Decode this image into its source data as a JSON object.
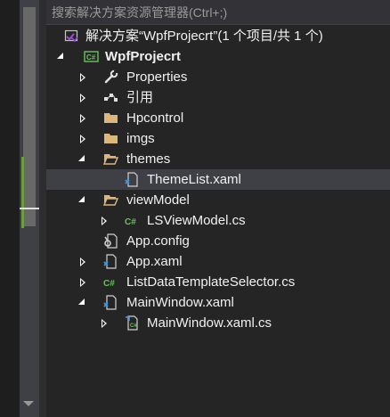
{
  "search": {
    "placeholder": "搜索解决方案资源管理器(Ctrl+;)"
  },
  "tree": {
    "solution": "解决方案“WpfProjecrt”(1 个项目/共 1 个)",
    "project": "WpfProjecrt",
    "items": {
      "properties": "Properties",
      "references": "引用",
      "hpcontrol": "Hpcontrol",
      "imgs": "imgs",
      "themes": "themes",
      "themelist": "ThemeList.xaml",
      "viewmodel": "viewModel",
      "lsviewmodel": "LSViewModel.cs",
      "appconfig": "App.config",
      "appxaml": "App.xaml",
      "selector": "ListDataTemplateSelector.cs",
      "mainwindow": "MainWindow.xaml",
      "mainwindowcs": "MainWindow.xaml.cs"
    }
  },
  "colors": {
    "background": "#252526",
    "selected_row": "#3f3f46",
    "folder": "#dcb67a",
    "csharp": "#68c35a",
    "text": "#f1f1f1"
  }
}
